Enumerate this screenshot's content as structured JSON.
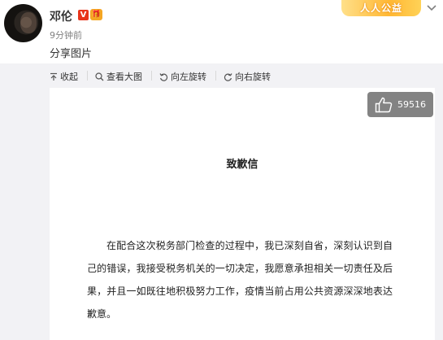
{
  "post": {
    "username": "邓伦",
    "verified_badge": "V",
    "timestamp": "9分钟前",
    "text": "分享图片",
    "charity_banner": "人人公益"
  },
  "toolbar": {
    "collapse_label": "收起",
    "view_large_label": "查看大图",
    "rotate_left_label": "向左旋转",
    "rotate_right_label": "向右旋转"
  },
  "image": {
    "like_count": "59516",
    "document_title": "致歉信",
    "document_body": "在配合这次税务部门检查的过程中，我已深刻自省，深刻认识到自己的错误，我接受税务机关的一切决定，我愿意承担相关一切责任及后果，并且一如既往地积极努力工作，疫情当前占用公共资源深深地表达歉意。"
  },
  "icons": [
    "avatar",
    "verified-icon",
    "gift-icon",
    "chevron-down-icon",
    "collapse-icon",
    "search-icon",
    "rotate-left-icon",
    "rotate-right-icon",
    "thumbs-up-icon"
  ],
  "colors": {
    "verified": "#e8351b",
    "toolbar_bg": "#f2f2f5",
    "charity": "#ffb733"
  }
}
